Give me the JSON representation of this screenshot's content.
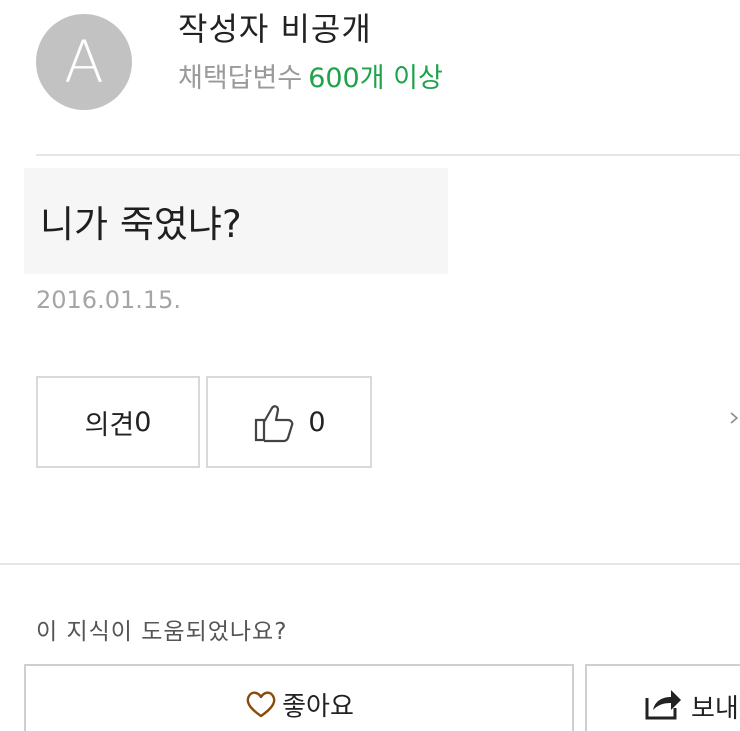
{
  "author": {
    "avatar_letter": "A",
    "name": "작성자 비공개",
    "stats_label": "채택답변수",
    "stats_value": "600개 이상",
    "stats_value_color": "#1fa34a"
  },
  "question": {
    "text": "니가 죽였냐?",
    "date": "2016.01.15."
  },
  "actions": {
    "comment_label": "의견",
    "comment_count": "0",
    "like_count": "0"
  },
  "feedback": {
    "prompt": "이 지식이 도움되었나요?",
    "like_label": "좋아요",
    "share_label": "보내"
  },
  "icons": {
    "avatar": "avatar-placeholder",
    "like": "thumbs-up-icon",
    "heart": "heart-icon",
    "share": "share-icon",
    "more": "chevron-right-icon"
  },
  "colors": {
    "heart": "#8a4b08",
    "accent_green": "#1fa34a"
  }
}
